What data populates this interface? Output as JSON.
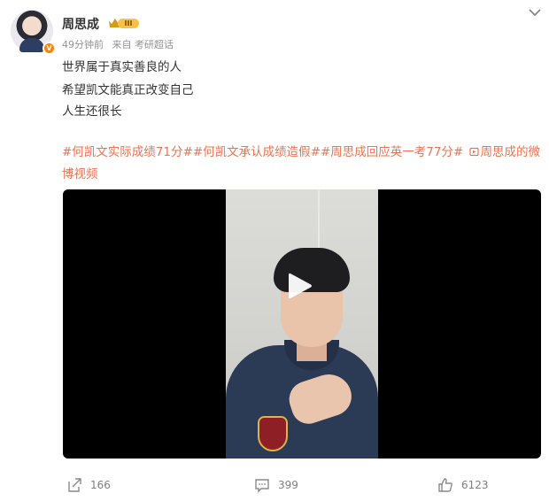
{
  "post": {
    "author": "周思成",
    "vip_level": "III",
    "verified_mark": "V",
    "time": "49分钟前",
    "source": "来自 考研超话",
    "lines": [
      "世界属于真实善良的人",
      "希望凯文能真正改变自己",
      "人生还很长"
    ],
    "hashtags": [
      "#何凯文实际成绩71分#",
      "#何凯文承认成绩造假#",
      "#周思成回应英一考77分#"
    ],
    "video_link": "周思成的微博视频"
  },
  "actions": {
    "repost_count": "166",
    "comment_count": "399",
    "like_count": "6123"
  },
  "icons": {
    "collapse": "chevron-down-icon",
    "repost": "share-icon",
    "comment": "comment-icon",
    "like": "thumbs-up-icon",
    "play": "play-icon",
    "video_link": "video-icon",
    "vip": "crown-icon"
  },
  "colors": {
    "accent": "#eb7350",
    "verified": "#ff8200",
    "vip_badge": "#f7c244",
    "meta_text": "#939393"
  }
}
